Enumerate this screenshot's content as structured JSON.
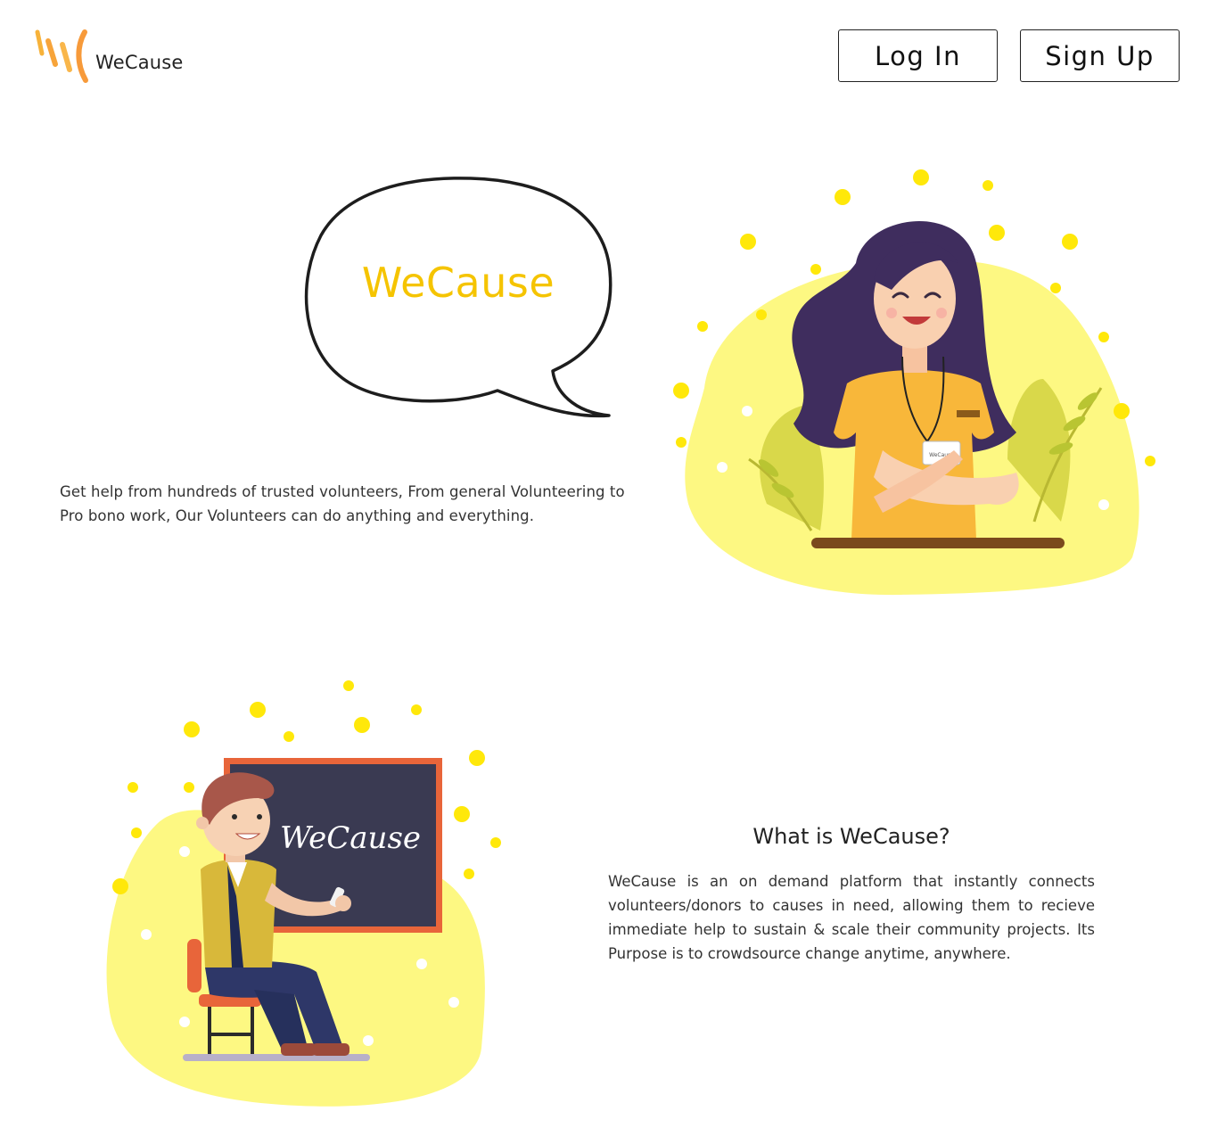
{
  "header": {
    "logo_text": "WeCause",
    "login_label": "Log In",
    "signup_label": "Sign Up"
  },
  "hero": {
    "bubble_text": "WeCause",
    "tagline": "Get help from hundreds of trusted volunteers, From general Volunteering to Pro bono work, Our Volunteers can do anything and everything.",
    "badge_text": "WeCause"
  },
  "about": {
    "chalkboard_text": "WeCause",
    "title": "What is WeCause?",
    "body": "WeCause is an on demand platform that instantly connects volunteers/donors to causes in need, allowing them to recieve immediate help to sustain & scale their community projects. Its Purpose is to crowdsource change anytime, anywhere."
  },
  "colors": {
    "brand_yellow": "#f5c400",
    "blob_yellow": "#fdf882",
    "dot_yellow": "#ffe80a",
    "logo_orange": "#f7a43a",
    "hair_purple": "#3f2d5e",
    "board_dark": "#3a3a52",
    "board_frame": "#e8653a"
  }
}
